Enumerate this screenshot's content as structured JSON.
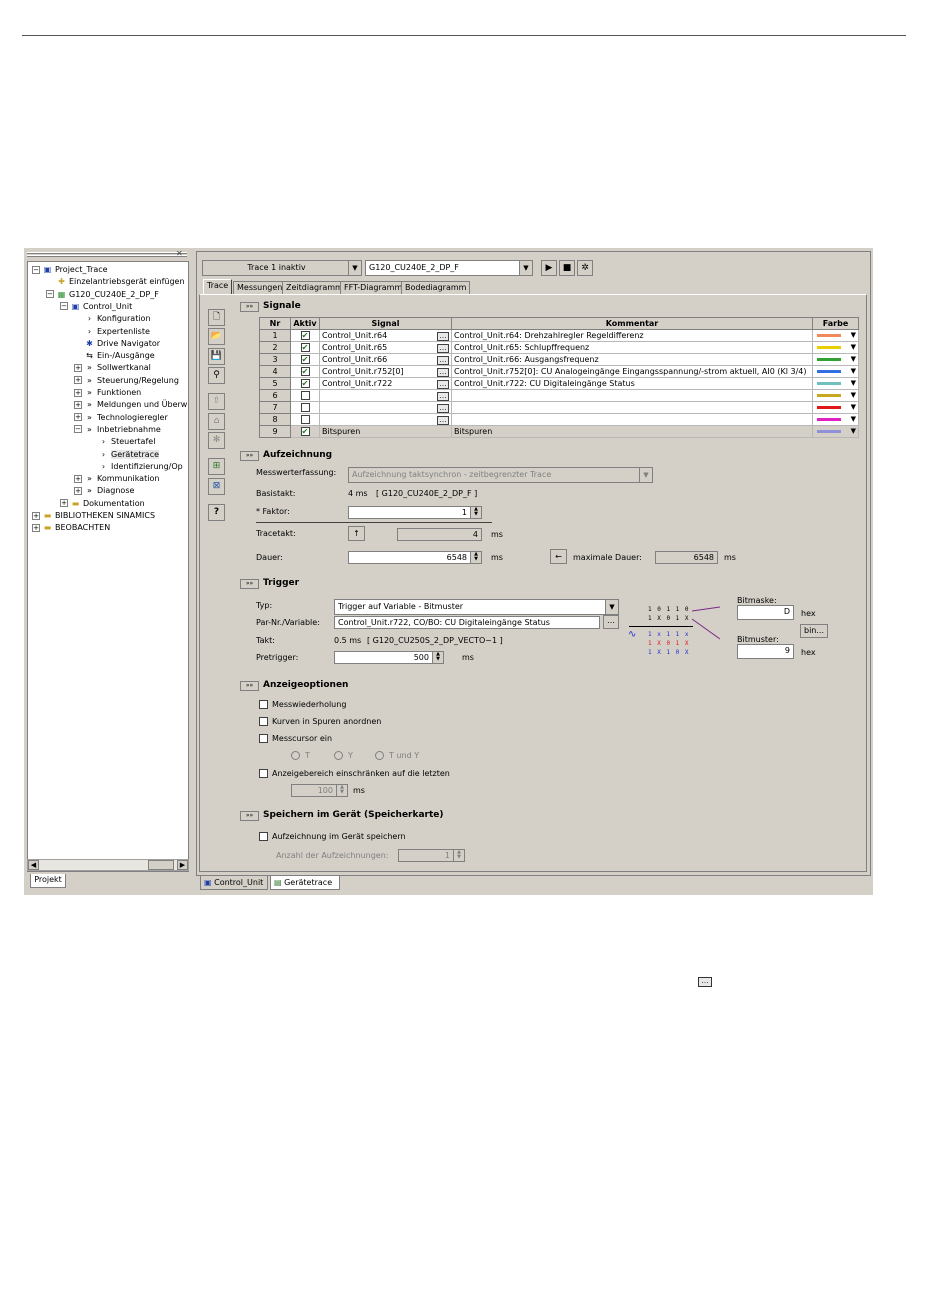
{
  "tree": {
    "items": [
      {
        "exp": "−",
        "icon": "▣",
        "cls": "blue",
        "label": "Project_Trace",
        "lv": 0
      },
      {
        "exp": "",
        "icon": "✚",
        "cls": "folder",
        "label": "Einzelantriebsgerät einfügen",
        "lv": 1
      },
      {
        "exp": "−",
        "icon": "▦",
        "cls": "green",
        "label": "G120_CU240E_2_DP_F",
        "lv": 1
      },
      {
        "exp": "−",
        "icon": "▣",
        "cls": "blue",
        "label": "Control_Unit",
        "lv": 2
      },
      {
        "exp": "",
        "icon": "›",
        "cls": "",
        "label": "Konfiguration",
        "lv": 3
      },
      {
        "exp": "",
        "icon": "›",
        "cls": "",
        "label": "Expertenliste",
        "lv": 3
      },
      {
        "exp": "",
        "icon": "✱",
        "cls": "blue",
        "label": "Drive Navigator",
        "lv": 3
      },
      {
        "exp": "",
        "icon": "⇆",
        "cls": "",
        "label": "Ein-/Ausgänge",
        "lv": 3
      },
      {
        "exp": "+",
        "icon": "»",
        "cls": "",
        "label": "Sollwertkanal",
        "lv": 3
      },
      {
        "exp": "+",
        "icon": "»",
        "cls": "",
        "label": "Steuerung/Regelung",
        "lv": 3
      },
      {
        "exp": "+",
        "icon": "»",
        "cls": "",
        "label": "Funktionen",
        "lv": 3
      },
      {
        "exp": "+",
        "icon": "»",
        "cls": "",
        "label": "Meldungen und Überw",
        "lv": 3
      },
      {
        "exp": "+",
        "icon": "»",
        "cls": "",
        "label": "Technologieregler",
        "lv": 3
      },
      {
        "exp": "−",
        "icon": "»",
        "cls": "",
        "label": "Inbetriebnahme",
        "lv": 3
      },
      {
        "exp": "",
        "icon": "›",
        "cls": "",
        "label": "Steuertafel",
        "lv": 4
      },
      {
        "exp": "",
        "icon": "›",
        "cls": "",
        "label": "Gerätetrace",
        "lv": 4,
        "selected": true
      },
      {
        "exp": "",
        "icon": "›",
        "cls": "",
        "label": "Identifizierung/Op",
        "lv": 4
      },
      {
        "exp": "+",
        "icon": "»",
        "cls": "",
        "label": "Kommunikation",
        "lv": 3
      },
      {
        "exp": "+",
        "icon": "»",
        "cls": "",
        "label": "Diagnose",
        "lv": 3
      },
      {
        "exp": "+",
        "icon": "▬",
        "cls": "folder",
        "label": "Dokumentation",
        "lv": 2
      },
      {
        "exp": "+",
        "icon": "▬",
        "cls": "folder",
        "label": "BIBLIOTHEKEN SINAMICS",
        "lv": 0
      },
      {
        "exp": "+",
        "icon": "▬",
        "cls": "folder",
        "label": "BEOBACHTEN",
        "lv": 0
      }
    ],
    "tab_label": "Projekt"
  },
  "toolbar": {
    "trace_select": "Trace 1 inaktiv",
    "device_select": "G120_CU240E_2_DP_F"
  },
  "tabs": [
    "Trace",
    "Messungen",
    "Zeitdiagramm",
    "FFT-Diagramm",
    "Bodediagramm"
  ],
  "signale": {
    "section_title": "Signale",
    "columns": [
      "Nr",
      "Aktiv",
      "Signal",
      "Kommentar",
      "Farbe"
    ],
    "rows": [
      {
        "nr": "1",
        "aktiv": true,
        "signal": "Control_Unit.r64",
        "kommentar": "Control_Unit.r64: Drehzahlregler Regeldifferenz",
        "farbe": "#f08a5a"
      },
      {
        "nr": "2",
        "aktiv": true,
        "signal": "Control_Unit.r65",
        "kommentar": "Control_Unit.r65: Schlupffrequenz",
        "farbe": "#e8d000"
      },
      {
        "nr": "3",
        "aktiv": true,
        "signal": "Control_Unit.r66",
        "kommentar": "Control_Unit.r66: Ausgangsfrequenz",
        "farbe": "#30a030"
      },
      {
        "nr": "4",
        "aktiv": true,
        "signal": "Control_Unit.r752[0]",
        "kommentar": "Control_Unit.r752[0]: CU Analogeingänge Eingangsspannung/-strom aktuell, AI0 (Kl 3/4)",
        "farbe": "#3070e0"
      },
      {
        "nr": "5",
        "aktiv": true,
        "signal": "Control_Unit.r722",
        "kommentar": "Control_Unit.r722: CU Digitaleingänge Status",
        "farbe": "#70c0c0"
      },
      {
        "nr": "6",
        "aktiv": false,
        "signal": "",
        "kommentar": "",
        "farbe": "#c8a820"
      },
      {
        "nr": "7",
        "aktiv": false,
        "signal": "",
        "kommentar": "",
        "farbe": "#e01818"
      },
      {
        "nr": "8",
        "aktiv": false,
        "signal": "",
        "kommentar": "",
        "farbe": "#e020c0"
      },
      {
        "nr": "9",
        "aktiv": true,
        "signal": "Bitspuren",
        "kommentar": "Bitspuren",
        "farbe": "#9090d8"
      }
    ]
  },
  "aufzeichnung": {
    "section_title": "Aufzeichnung",
    "messwert_label": "Messwerterfassung:",
    "messwert_value": "Aufzeichnung taktsynchron - zeitbegrenzter Trace",
    "basistakt_label": "Basistakt:",
    "basistakt_value": "4 ms",
    "basistakt_device": "[ G120_CU240E_2_DP_F ]",
    "faktor_label": "* Faktor:",
    "faktor_value": "1",
    "tracetakt_label": "Tracetakt:",
    "tracetakt_value": "4",
    "tracetakt_unit": "ms",
    "dauer_label": "Dauer:",
    "dauer_value": "6548",
    "dauer_unit": "ms",
    "max_dauer_label": "maximale Dauer:",
    "max_dauer_value": "6548",
    "max_dauer_unit": "ms"
  },
  "trigger": {
    "section_title": "Trigger",
    "typ_label": "Typ:",
    "typ_value": "Trigger auf Variable - Bitmuster",
    "par_label": "Par-Nr./Variable:",
    "par_value": "Control_Unit.r722, CO/BO: CU Digitaleingänge Status",
    "takt_label": "Takt:",
    "takt_value": "0.5 ms",
    "takt_device": "[ G120_CU250S_2_DP_VECTO~1 ]",
    "pretrigger_label": "Pretrigger:",
    "pretrigger_value": "500",
    "pretrigger_unit": "ms",
    "bitmaske_label": "Bitmaske:",
    "bitmaske_value": "D",
    "bitmaske_unit": "hex",
    "bitmuster_label": "Bitmuster:",
    "bitmuster_value": "9",
    "bitmuster_unit": "hex",
    "bin_button": "bin...",
    "bits_row1": "1 0 1 1 0",
    "bits_row2": "1 X 0 1 X",
    "bits_row3": "1 x 1 1 x",
    "bits_row4": "1 X 0 1 X",
    "bits_row5": "1 X 1 0 X"
  },
  "anzeige": {
    "section_title": "Anzeigeoptionen",
    "opt1": "Messwiederholung",
    "opt2": "Kurven in Spuren anordnen",
    "opt3": "Messcursor ein",
    "radio1": "T",
    "radio2": "Y",
    "radio3": "T und Y",
    "opt4": "Anzeigebereich einschränken auf die letzten",
    "range_value": "100",
    "range_unit": "ms"
  },
  "speichern": {
    "section_title": "Speichern im Gerät (Speicherkarte)",
    "opt1": "Aufzeichnung im Gerät speichern",
    "count_label": "Anzahl der Aufzeichnungen:",
    "count_value": "1"
  },
  "doctabs": [
    "Control_Unit",
    "Gerätetrace"
  ]
}
